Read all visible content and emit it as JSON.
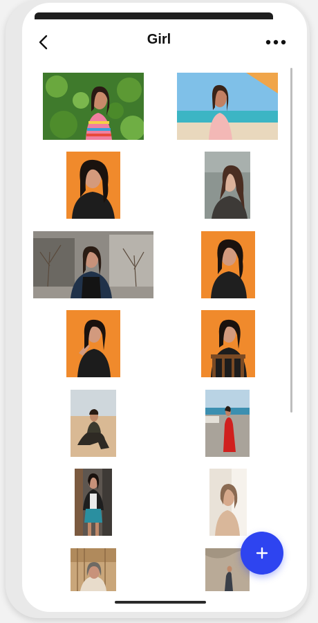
{
  "header": {
    "title": "Girl",
    "back_icon": "chevron-left-icon",
    "more_icon": "more-horizontal-icon"
  },
  "gallery": {
    "photos": [
      {
        "id": "photo-1",
        "subject": "woman-striped-dress-green-leaves"
      },
      {
        "id": "photo-2",
        "subject": "woman-pink-top-beach"
      },
      {
        "id": "photo-3",
        "subject": "woman-orange-backdrop-glasses"
      },
      {
        "id": "photo-4",
        "subject": "woman-long-hair-grey"
      },
      {
        "id": "photo-5",
        "subject": "woman-street-trees-buildings"
      },
      {
        "id": "photo-6",
        "subject": "woman-orange-backdrop-black-top"
      },
      {
        "id": "photo-7",
        "subject": "woman-orange-backdrop-posing"
      },
      {
        "id": "photo-8",
        "subject": "woman-orange-backdrop-chair"
      },
      {
        "id": "photo-9",
        "subject": "woman-sitting-sand"
      },
      {
        "id": "photo-10",
        "subject": "woman-red-dress-waterfront"
      },
      {
        "id": "photo-11",
        "subject": "woman-denim-skirt-street"
      },
      {
        "id": "photo-12",
        "subject": "woman-window-light"
      },
      {
        "id": "photo-13",
        "subject": "woman-hijab-indoor"
      },
      {
        "id": "photo-14",
        "subject": "woman-walking-sand"
      }
    ]
  },
  "fab": {
    "icon": "plus-icon",
    "color": "#2E44F0"
  },
  "colors": {
    "accent": "#2E44F0",
    "orange_backdrop": "#F08A2C"
  }
}
